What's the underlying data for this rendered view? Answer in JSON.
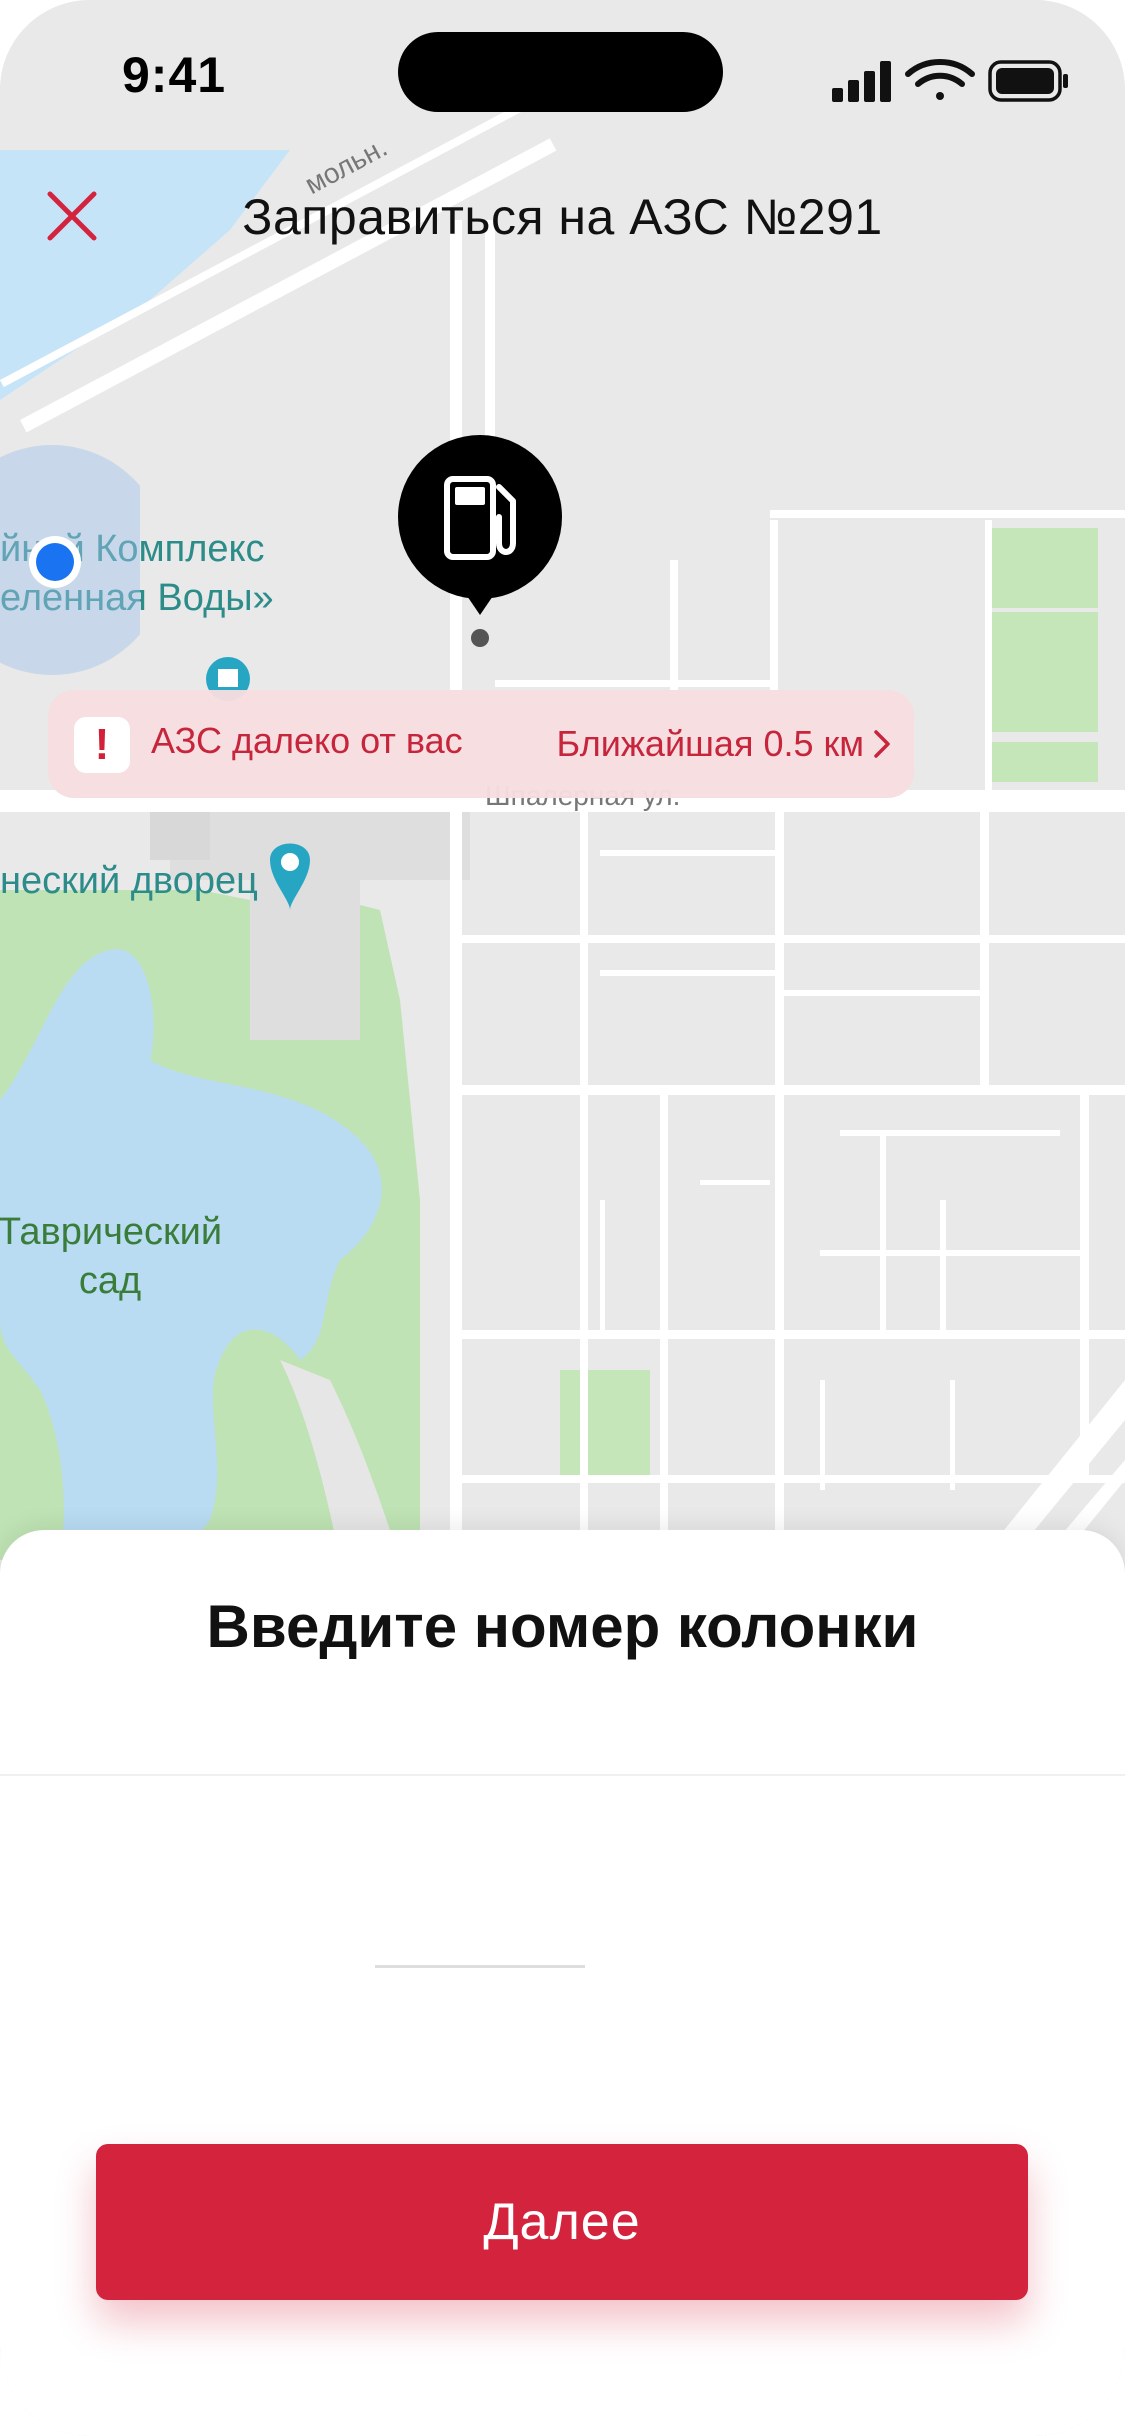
{
  "status_bar": {
    "time": "9:41"
  },
  "header": {
    "title": "Заправиться на АЗС №291",
    "close_icon": "close-icon"
  },
  "map": {
    "labels": {
      "complex_line1": "йний Комплекс",
      "complex_line2": "еленная Воды»",
      "palace": "неский дворец",
      "garden_line1": "Таврический",
      "garden_line2": "сад",
      "street_top": "мольн.",
      "street_mid": "Шпалерная ул."
    }
  },
  "alert": {
    "icon": "!",
    "message": "АЗС далеко от вас",
    "link": "Ближайшая 0.5 км"
  },
  "sheet": {
    "title": "Введите номер колонки",
    "input_value": "",
    "input_placeholder": ""
  },
  "actions": {
    "next_label": "Далее"
  },
  "colors": {
    "accent": "#d3233d",
    "alert_bg": "#f6dde0",
    "alert_text": "#c6253b",
    "map_water": "#bfe0f7",
    "map_park": "#bfe3b4",
    "user_location": "#1a73f0"
  }
}
